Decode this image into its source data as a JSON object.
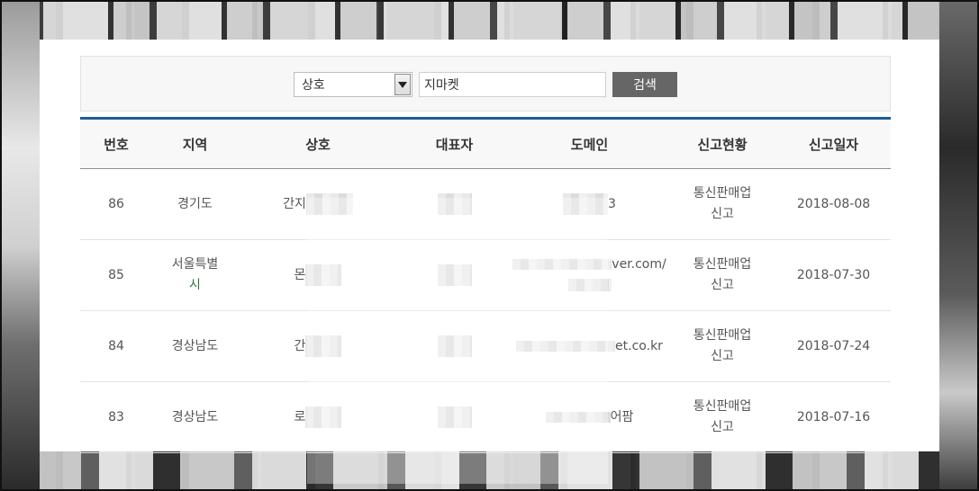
{
  "search": {
    "select_label": "상호",
    "input_value": "지마켓",
    "button_label": "검색"
  },
  "table": {
    "headers": [
      "번호",
      "지역",
      "상호",
      "대표자",
      "도메인",
      "신고현황",
      "신고일자"
    ],
    "rows": [
      {
        "num": "86",
        "region_1": "경기도",
        "region_2": "",
        "name_prefix": "간지",
        "domain_suffix": "3",
        "domain_prefix": "",
        "status_1": "통신판매업",
        "status_2": "신고",
        "date": "2018-08-08"
      },
      {
        "num": "85",
        "region_1": "서울특별",
        "region_2": "시",
        "name_prefix": "몬",
        "domain_suffix": "ver.com/",
        "domain_prefix": "",
        "status_1": "통신판매업",
        "status_2": "신고",
        "date": "2018-07-30"
      },
      {
        "num": "84",
        "region_1": "경상남도",
        "region_2": "",
        "name_prefix": "간",
        "domain_suffix": "et.co.kr",
        "domain_prefix": "",
        "status_1": "통신판매업",
        "status_2": "신고",
        "date": "2018-07-24"
      },
      {
        "num": "83",
        "region_1": "경상남도",
        "region_2": "",
        "name_prefix": "로",
        "domain_suffix": "어팜",
        "domain_prefix": "",
        "status_1": "통신판매업",
        "status_2": "신고",
        "date": "2018-07-16"
      }
    ]
  }
}
